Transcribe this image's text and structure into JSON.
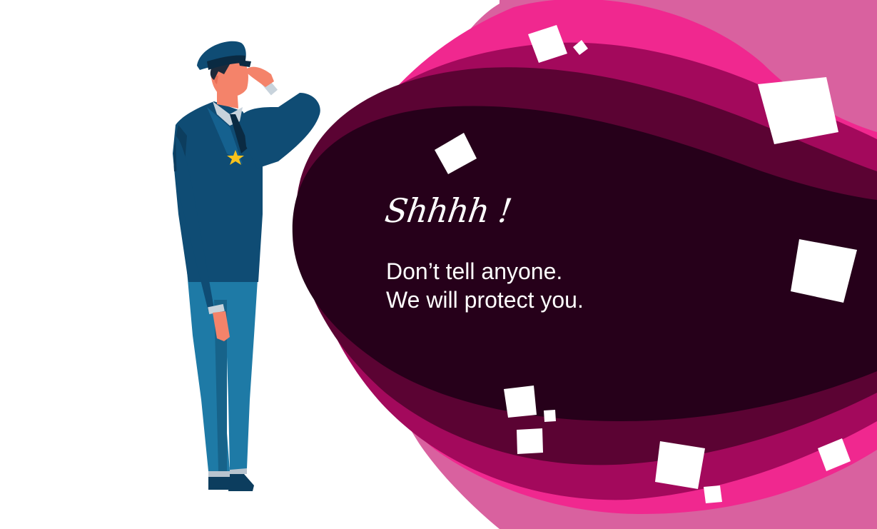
{
  "heading": "Shhhh !",
  "message": {
    "line1": "Don’t tell anyone.",
    "line2": "We will protect you."
  },
  "colors": {
    "background": "#ffffff",
    "blob_outer": "#d9619f",
    "blob_pink": "#f0288f",
    "blob_magenta": "#a3095c",
    "blob_wine": "#5b0333",
    "blob_core": "#26001a",
    "text": "#ffffff",
    "uniform_dark": "#0c3d5e",
    "uniform_trousers": "#1e7aa6",
    "skin": "#f4836a",
    "badge_star": "#f6c21c"
  },
  "icons": [
    "saluting-officer-illustration",
    "star-badge-icon",
    "floating-paper-square"
  ]
}
